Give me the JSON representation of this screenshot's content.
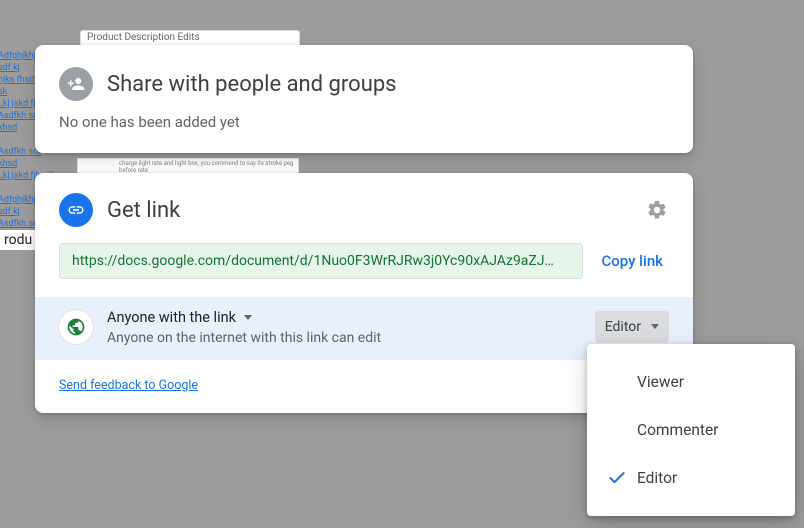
{
  "background": {
    "card_title": "Product Description Edits",
    "prod_label": "rodu",
    "faint_caption": "charge light rate and light box, you commend to say its stroke peg before rate"
  },
  "share": {
    "title": "Share with people and groups",
    "subtitle": "No one has been added yet"
  },
  "link": {
    "title": "Get link",
    "url": "https://docs.google.com/document/d/1Nuo0F3WrRJRw3j0Yc90xAJAz9aZJ…",
    "copy_label": "Copy link",
    "access_label": "Anyone with the link",
    "access_desc": "Anyone on the internet with this link can edit",
    "role_button": "Editor",
    "feedback": "Send feedback to Google"
  },
  "dropdown": {
    "options": [
      "Viewer",
      "Commenter",
      "Editor"
    ],
    "selected_index": 2
  },
  "colors": {
    "accent": "#1a73e8",
    "green": "#137333",
    "access_bg": "#e8f0fe"
  }
}
